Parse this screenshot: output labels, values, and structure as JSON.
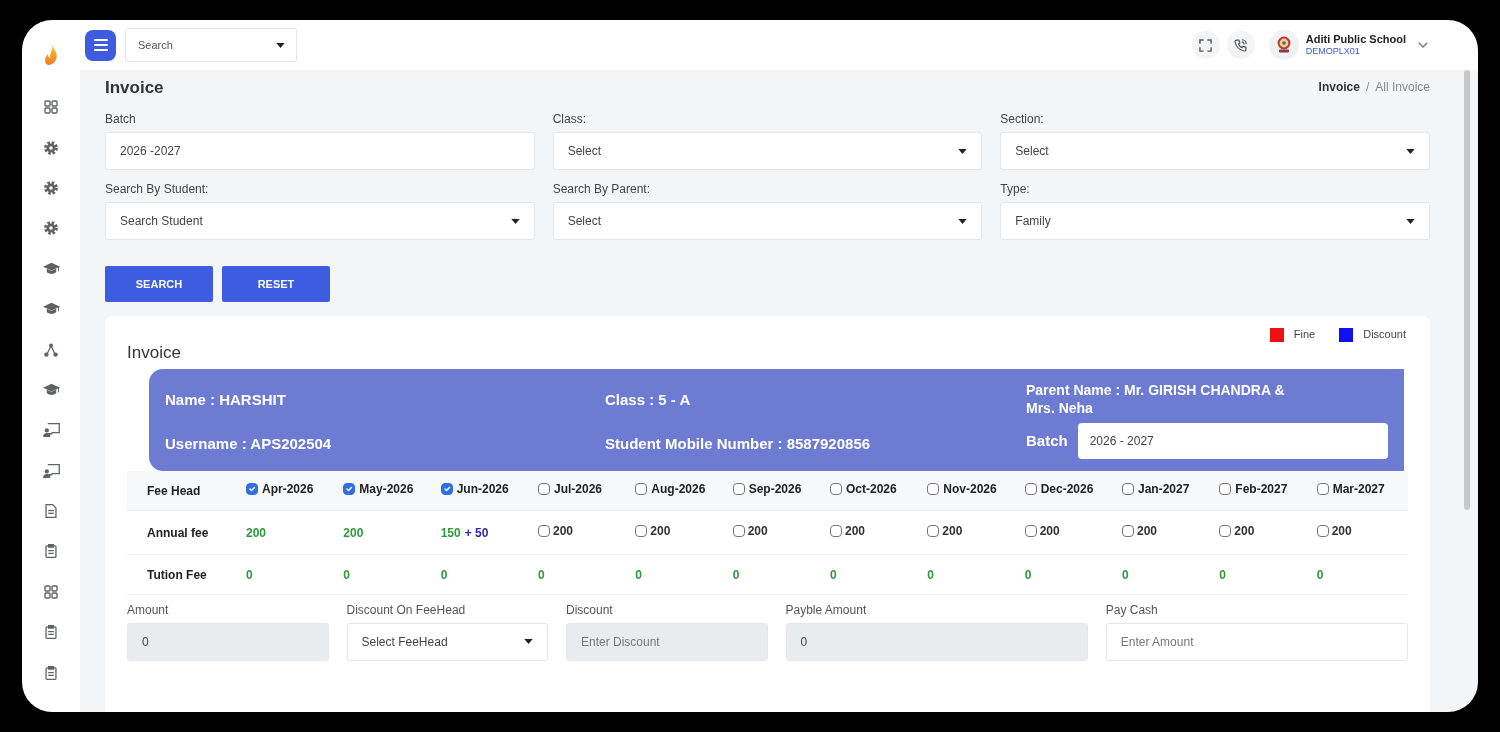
{
  "top_bar": {
    "search": {
      "placeholder": "Search"
    },
    "school": {
      "name": "Aditi Public School",
      "code": "DEMOPLX01"
    }
  },
  "page": {
    "title": "Invoice",
    "breadcrumb": {
      "separator": "/",
      "items": [
        {
          "label": "Invoice",
          "current": false
        },
        {
          "label": "All Invoice",
          "current": true
        }
      ]
    }
  },
  "filters": [
    {
      "label": "Batch",
      "kind": "input",
      "value": "2026 -2027"
    },
    {
      "label": "Class:",
      "kind": "select",
      "value": "Select"
    },
    {
      "label": "Section:",
      "kind": "select",
      "value": "Select"
    },
    {
      "label": "Search By Student:",
      "kind": "select",
      "value": "Search Student"
    },
    {
      "label": "Search By Parent:",
      "kind": "select",
      "value": "Select"
    },
    {
      "label": "Type:",
      "kind": "select",
      "value": "Family"
    }
  ],
  "buttons": [
    "SEARCH",
    "RESET"
  ],
  "invoice": {
    "title": "Invoice",
    "legend": [
      {
        "label": "Fine",
        "color": "#ee1111"
      },
      {
        "label": "Discount",
        "color": "#1111ee"
      }
    ],
    "student": {
      "name": "Name : HARSHIT",
      "username": "Username : APS202504",
      "class": "Class : 5 - A",
      "mobile": "Student Mobile Number : 8587920856",
      "parent": "Parent Name : Mr. GIRISH CHANDRA & Mrs. Neha",
      "batch_label": "Batch",
      "batch_value": "2026 - 2027"
    },
    "table": {
      "head_label": "Fee Head",
      "months": [
        {
          "label": "Apr-2026",
          "checked": true
        },
        {
          "label": "May-2026",
          "checked": true
        },
        {
          "label": "Jun-2026",
          "checked": true
        },
        {
          "label": "Jul-2026",
          "checked": false
        },
        {
          "label": "Aug-2026",
          "checked": false
        },
        {
          "label": "Sep-2026",
          "checked": false
        },
        {
          "label": "Oct-2026",
          "checked": false
        },
        {
          "label": "Nov-2026",
          "checked": false
        },
        {
          "label": "Dec-2026",
          "checked": false
        },
        {
          "label": "Jan-2027",
          "checked": false
        },
        {
          "label": "Feb-2027",
          "checked": false
        },
        {
          "label": "Mar-2027",
          "checked": false
        }
      ],
      "rows": [
        {
          "label": "Annual fee",
          "cells": [
            {
              "kind": "amount",
              "amount": "200"
            },
            {
              "kind": "amount",
              "amount": "200"
            },
            {
              "kind": "amount",
              "amount": "150",
              "discount": "+ 50"
            },
            {
              "kind": "option",
              "amount": "200",
              "checked": false
            },
            {
              "kind": "option",
              "amount": "200",
              "checked": false
            },
            {
              "kind": "option",
              "amount": "200",
              "checked": false
            },
            {
              "kind": "option",
              "amount": "200",
              "checked": false
            },
            {
              "kind": "option",
              "amount": "200",
              "checked": false
            },
            {
              "kind": "option",
              "amount": "200",
              "checked": false
            },
            {
              "kind": "option",
              "amount": "200",
              "checked": false
            },
            {
              "kind": "option",
              "amount": "200",
              "checked": false
            },
            {
              "kind": "option",
              "amount": "200",
              "checked": false
            }
          ]
        },
        {
          "label": "Tution Fee",
          "cells": [
            {
              "kind": "amount",
              "amount": "0"
            },
            {
              "kind": "amount",
              "amount": "0"
            },
            {
              "kind": "amount",
              "amount": "0"
            },
            {
              "kind": "amount",
              "amount": "0"
            },
            {
              "kind": "amount",
              "amount": "0"
            },
            {
              "kind": "amount",
              "amount": "0"
            },
            {
              "kind": "amount",
              "amount": "0"
            },
            {
              "kind": "amount",
              "amount": "0"
            },
            {
              "kind": "amount",
              "amount": "0"
            },
            {
              "kind": "amount",
              "amount": "0"
            },
            {
              "kind": "amount",
              "amount": "0"
            },
            {
              "kind": "amount",
              "amount": "0"
            }
          ]
        }
      ]
    },
    "payment": [
      {
        "label": "Amount",
        "kind": "readonly",
        "value": "0"
      },
      {
        "label": "Discount On FeeHead",
        "kind": "select",
        "value": "Select FeeHead"
      },
      {
        "label": "Discount",
        "kind": "disabled",
        "placeholder": "Enter Discount"
      },
      {
        "label": "Payble Amount",
        "kind": "readonly",
        "value": "0"
      },
      {
        "label": "Pay Cash",
        "kind": "input",
        "placeholder": "Enter Amount"
      }
    ]
  }
}
